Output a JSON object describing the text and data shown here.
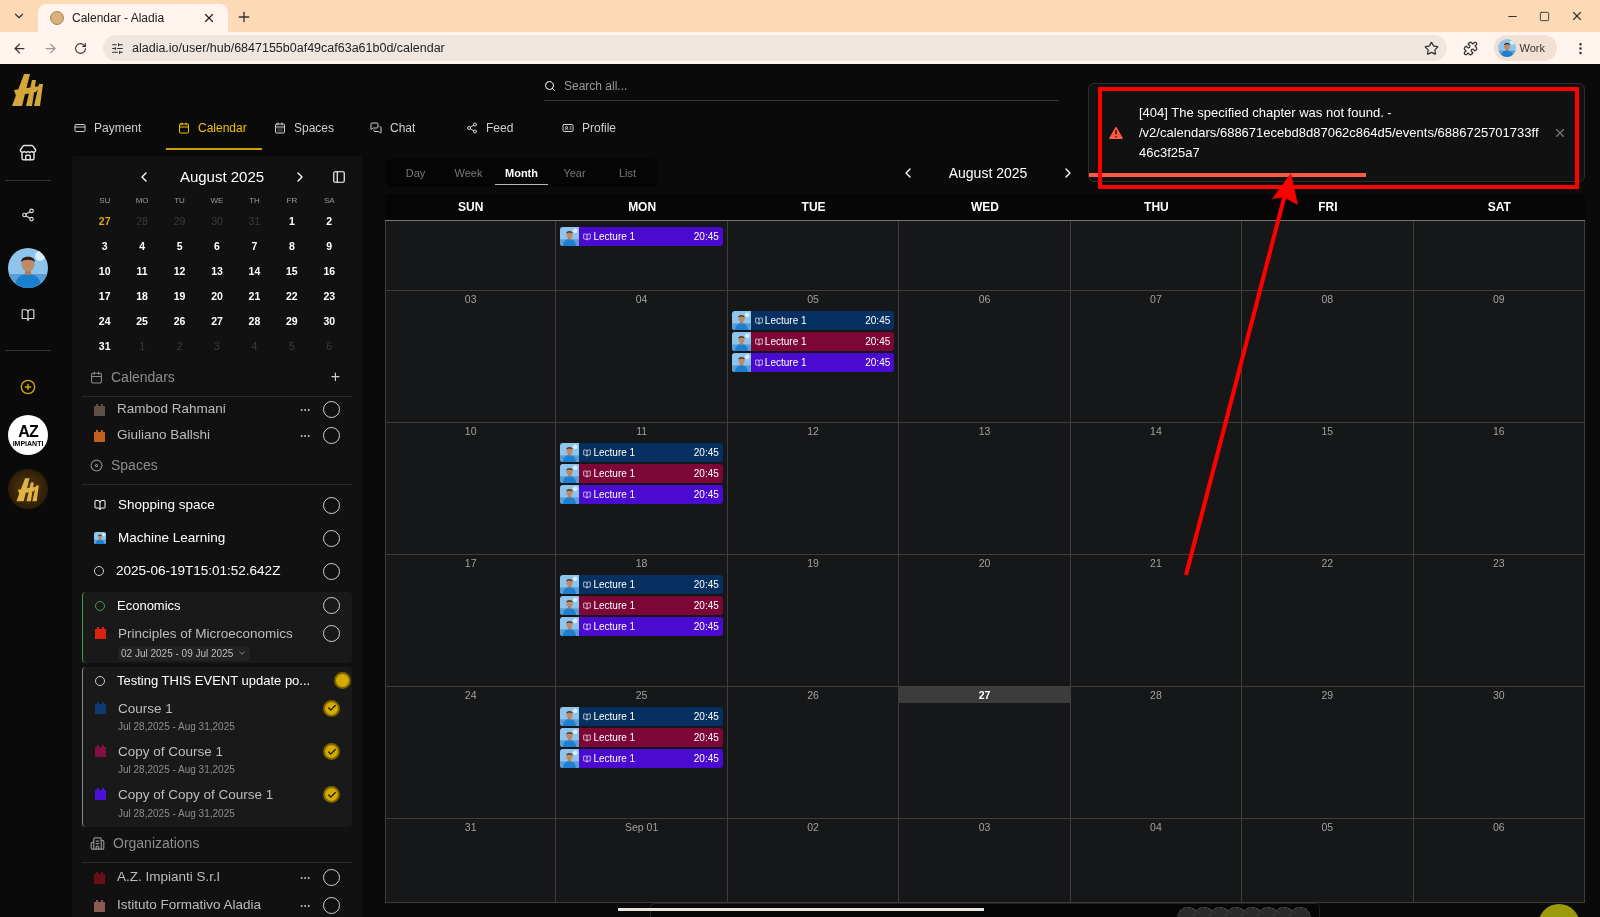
{
  "browser": {
    "tab_title": "Calendar - Aladia",
    "url": "aladia.io/user/hub/6847155b0af49caf63a61b0d/calendar",
    "profile": "Work"
  },
  "rail": {
    "logo_text": "AZ",
    "logo_subtext": "IMPIANTI"
  },
  "search": {
    "placeholder": "Search all..."
  },
  "nav": [
    {
      "label": "Payment",
      "selected": false
    },
    {
      "label": "Calendar",
      "selected": true
    },
    {
      "label": "Spaces",
      "selected": false
    },
    {
      "label": "Chat",
      "selected": false
    },
    {
      "label": "Feed",
      "selected": false
    },
    {
      "label": "Profile",
      "selected": false
    }
  ],
  "mini_calendar": {
    "title": "August 2025",
    "weekdays": [
      "SU",
      "MO",
      "TU",
      "WE",
      "TH",
      "FR",
      "SA"
    ],
    "days": [
      {
        "label": "27",
        "muted": false,
        "highlighted": true
      },
      {
        "label": "28",
        "muted": true,
        "highlighted": false
      },
      {
        "label": "29",
        "muted": true,
        "highlighted": false
      },
      {
        "label": "30",
        "muted": true,
        "highlighted": false
      },
      {
        "label": "31",
        "muted": true,
        "highlighted": false
      },
      {
        "label": "1",
        "muted": false,
        "highlighted": false
      },
      {
        "label": "2",
        "muted": false,
        "highlighted": false
      },
      {
        "label": "3",
        "muted": false,
        "highlighted": false
      },
      {
        "label": "4",
        "muted": false,
        "highlighted": false
      },
      {
        "label": "5",
        "muted": false,
        "highlighted": false
      },
      {
        "label": "6",
        "muted": false,
        "highlighted": false
      },
      {
        "label": "7",
        "muted": false,
        "highlighted": false
      },
      {
        "label": "8",
        "muted": false,
        "highlighted": false
      },
      {
        "label": "9",
        "muted": false,
        "highlighted": false
      },
      {
        "label": "10",
        "muted": false,
        "highlighted": false
      },
      {
        "label": "11",
        "muted": false,
        "highlighted": false
      },
      {
        "label": "12",
        "muted": false,
        "highlighted": false
      },
      {
        "label": "13",
        "muted": false,
        "highlighted": false
      },
      {
        "label": "14",
        "muted": false,
        "highlighted": false
      },
      {
        "label": "15",
        "muted": false,
        "highlighted": false
      },
      {
        "label": "16",
        "muted": false,
        "highlighted": false
      },
      {
        "label": "17",
        "muted": false,
        "highlighted": false
      },
      {
        "label": "18",
        "muted": false,
        "highlighted": false
      },
      {
        "label": "19",
        "muted": false,
        "highlighted": false
      },
      {
        "label": "20",
        "muted": false,
        "highlighted": false
      },
      {
        "label": "21",
        "muted": false,
        "highlighted": false
      },
      {
        "label": "22",
        "muted": false,
        "highlighted": false
      },
      {
        "label": "23",
        "muted": false,
        "highlighted": false
      },
      {
        "label": "24",
        "muted": false,
        "highlighted": false
      },
      {
        "label": "25",
        "muted": false,
        "highlighted": false
      },
      {
        "label": "26",
        "muted": false,
        "highlighted": false
      },
      {
        "label": "27",
        "muted": false,
        "highlighted": false
      },
      {
        "label": "28",
        "muted": false,
        "highlighted": false
      },
      {
        "label": "29",
        "muted": false,
        "highlighted": false
      },
      {
        "label": "30",
        "muted": false,
        "highlighted": false
      },
      {
        "label": "31",
        "muted": false,
        "highlighted": false
      },
      {
        "label": "1",
        "muted": true,
        "highlighted": false
      },
      {
        "label": "2",
        "muted": true,
        "highlighted": false
      },
      {
        "label": "3",
        "muted": true,
        "highlighted": false
      },
      {
        "label": "4",
        "muted": true,
        "highlighted": false
      },
      {
        "label": "5",
        "muted": true,
        "highlighted": false
      },
      {
        "label": "6",
        "muted": true,
        "highlighted": false
      }
    ]
  },
  "calendars": {
    "title": "Calendars",
    "add": "+",
    "items": [
      {
        "name": "Rambod Rahmani",
        "color": "#5e5046",
        "checked": false
      },
      {
        "name": "Giuliano Ballshi",
        "color": "#c0601a",
        "checked": false
      }
    ]
  },
  "spaces": {
    "title": "Spaces",
    "items": [
      {
        "kind": "shop",
        "name": "Shopping space",
        "checked": false
      },
      {
        "kind": "picture",
        "name": "Machine Learning",
        "checked": false
      },
      {
        "kind": "ring",
        "name": "2025-06-19T15:01:52.642Z",
        "checked": false
      }
    ],
    "groups": [
      {
        "name": "Economics",
        "color": "#3f9a5a",
        "checked": false,
        "children": [
          {
            "kind": "range",
            "name": "Principles of Microeconomics",
            "color": "#d8230f",
            "date": "02 Jul 2025 - 09 Jul 2025",
            "checked": false
          }
        ]
      },
      {
        "name": "Testing THIS EVENT update po...",
        "color": "#8a8a8a",
        "checked": true,
        "children": [
          {
            "kind": "plain",
            "name": "Course 1",
            "color": "#0d3a73",
            "date": "Jul 28,2025 - Aug 31,2025",
            "checked": true
          },
          {
            "kind": "plain",
            "name": "Copy of Course 1",
            "color": "#80103f",
            "date": "Jul 28,2025 - Aug 31,2025",
            "checked": true
          },
          {
            "kind": "plain",
            "name": "Copy of Copy of Course 1",
            "color": "#4a12d8",
            "date": "Jul 28,2025 - Aug 31,2025",
            "checked": true
          }
        ]
      }
    ]
  },
  "organizations": {
    "title": "Organizations",
    "items": [
      {
        "name": "A.Z. Impianti S.r.l",
        "color": "#6b0f16",
        "checked": false
      },
      {
        "name": "Istituto Formativo Aladia",
        "color": "#8a5a50",
        "checked": false
      }
    ]
  },
  "calendar": {
    "views": [
      {
        "label": "Day",
        "selected": false
      },
      {
        "label": "Week",
        "selected": false
      },
      {
        "label": "Month",
        "selected": true
      },
      {
        "label": "Year",
        "selected": false
      },
      {
        "label": "List",
        "selected": false
      }
    ],
    "title": "August 2025",
    "weekdays": [
      "SUN",
      "MON",
      "TUE",
      "WED",
      "THU",
      "FRI",
      "SAT"
    ],
    "weeks": [
      [
        {
          "kind": "blank"
        },
        {
          "kind": "day",
          "events": [
            {
              "title": "Lecture 1",
              "time": "20:45",
              "color": "#4a0ad0"
            }
          ]
        },
        {
          "kind": "blank"
        },
        {
          "kind": "blank"
        },
        {
          "kind": "blank"
        },
        {
          "kind": "blank"
        },
        {
          "kind": "blank"
        }
      ],
      [
        {
          "label": "03",
          "today": false
        },
        {
          "label": "04",
          "today": false
        },
        {
          "label": "05",
          "today": false,
          "events": [
            {
              "title": "Lecture 1",
              "time": "20:45",
              "color": "#06305f"
            },
            {
              "title": "Lecture 1",
              "time": "20:45",
              "color": "#7c0736"
            },
            {
              "title": "Lecture 1",
              "time": "20:45",
              "color": "#4a0ad0"
            }
          ]
        },
        {
          "label": "06",
          "today": false
        },
        {
          "label": "07",
          "today": false
        },
        {
          "label": "08",
          "today": false
        },
        {
          "label": "09",
          "today": false
        }
      ],
      [
        {
          "label": "10",
          "today": false
        },
        {
          "label": "11",
          "today": false,
          "events": [
            {
              "title": "Lecture 1",
              "time": "20:45",
              "color": "#06305f"
            },
            {
              "title": "Lecture 1",
              "time": "20:45",
              "color": "#7c0736"
            },
            {
              "title": "Lecture 1",
              "time": "20:45",
              "color": "#4a0ad0"
            }
          ]
        },
        {
          "label": "12",
          "today": false
        },
        {
          "label": "13",
          "today": false
        },
        {
          "label": "14",
          "today": false
        },
        {
          "label": "15",
          "today": false
        },
        {
          "label": "16",
          "today": false
        }
      ],
      [
        {
          "label": "17",
          "today": false
        },
        {
          "label": "18",
          "today": false,
          "events": [
            {
              "title": "Lecture 1",
              "time": "20:45",
              "color": "#06305f"
            },
            {
              "title": "Lecture 1",
              "time": "20:45",
              "color": "#7c0736"
            },
            {
              "title": "Lecture 1",
              "time": "20:45",
              "color": "#4a0ad0"
            }
          ]
        },
        {
          "label": "19",
          "today": false
        },
        {
          "label": "20",
          "today": false
        },
        {
          "label": "21",
          "today": false
        },
        {
          "label": "22",
          "today": false
        },
        {
          "label": "23",
          "today": false
        }
      ],
      [
        {
          "label": "24",
          "today": false
        },
        {
          "label": "25",
          "today": false,
          "events": [
            {
              "title": "Lecture 1",
              "time": "20:45",
              "color": "#06305f"
            },
            {
              "title": "Lecture 1",
              "time": "20:45",
              "color": "#7c0736"
            },
            {
              "title": "Lecture 1",
              "time": "20:45",
              "color": "#4a0ad0"
            }
          ]
        },
        {
          "label": "26",
          "today": false
        },
        {
          "label": "27",
          "today": true
        },
        {
          "label": "28",
          "today": false
        },
        {
          "label": "29",
          "today": false
        },
        {
          "label": "30",
          "today": false
        }
      ],
      [
        {
          "label": "31",
          "today": false
        },
        {
          "label": "Sep 01",
          "today": false
        },
        {
          "label": "02",
          "today": false
        },
        {
          "label": "03",
          "today": false
        },
        {
          "label": "04",
          "today": false
        },
        {
          "label": "05",
          "today": false
        },
        {
          "label": "06",
          "today": false
        }
      ]
    ]
  },
  "toast": {
    "message": "[404] The specified chapter was not found. - /v2/calendars/688671ecebd8d87062c864d5/events/6886725701733ff46c3f25a7",
    "level": 0.56
  }
}
